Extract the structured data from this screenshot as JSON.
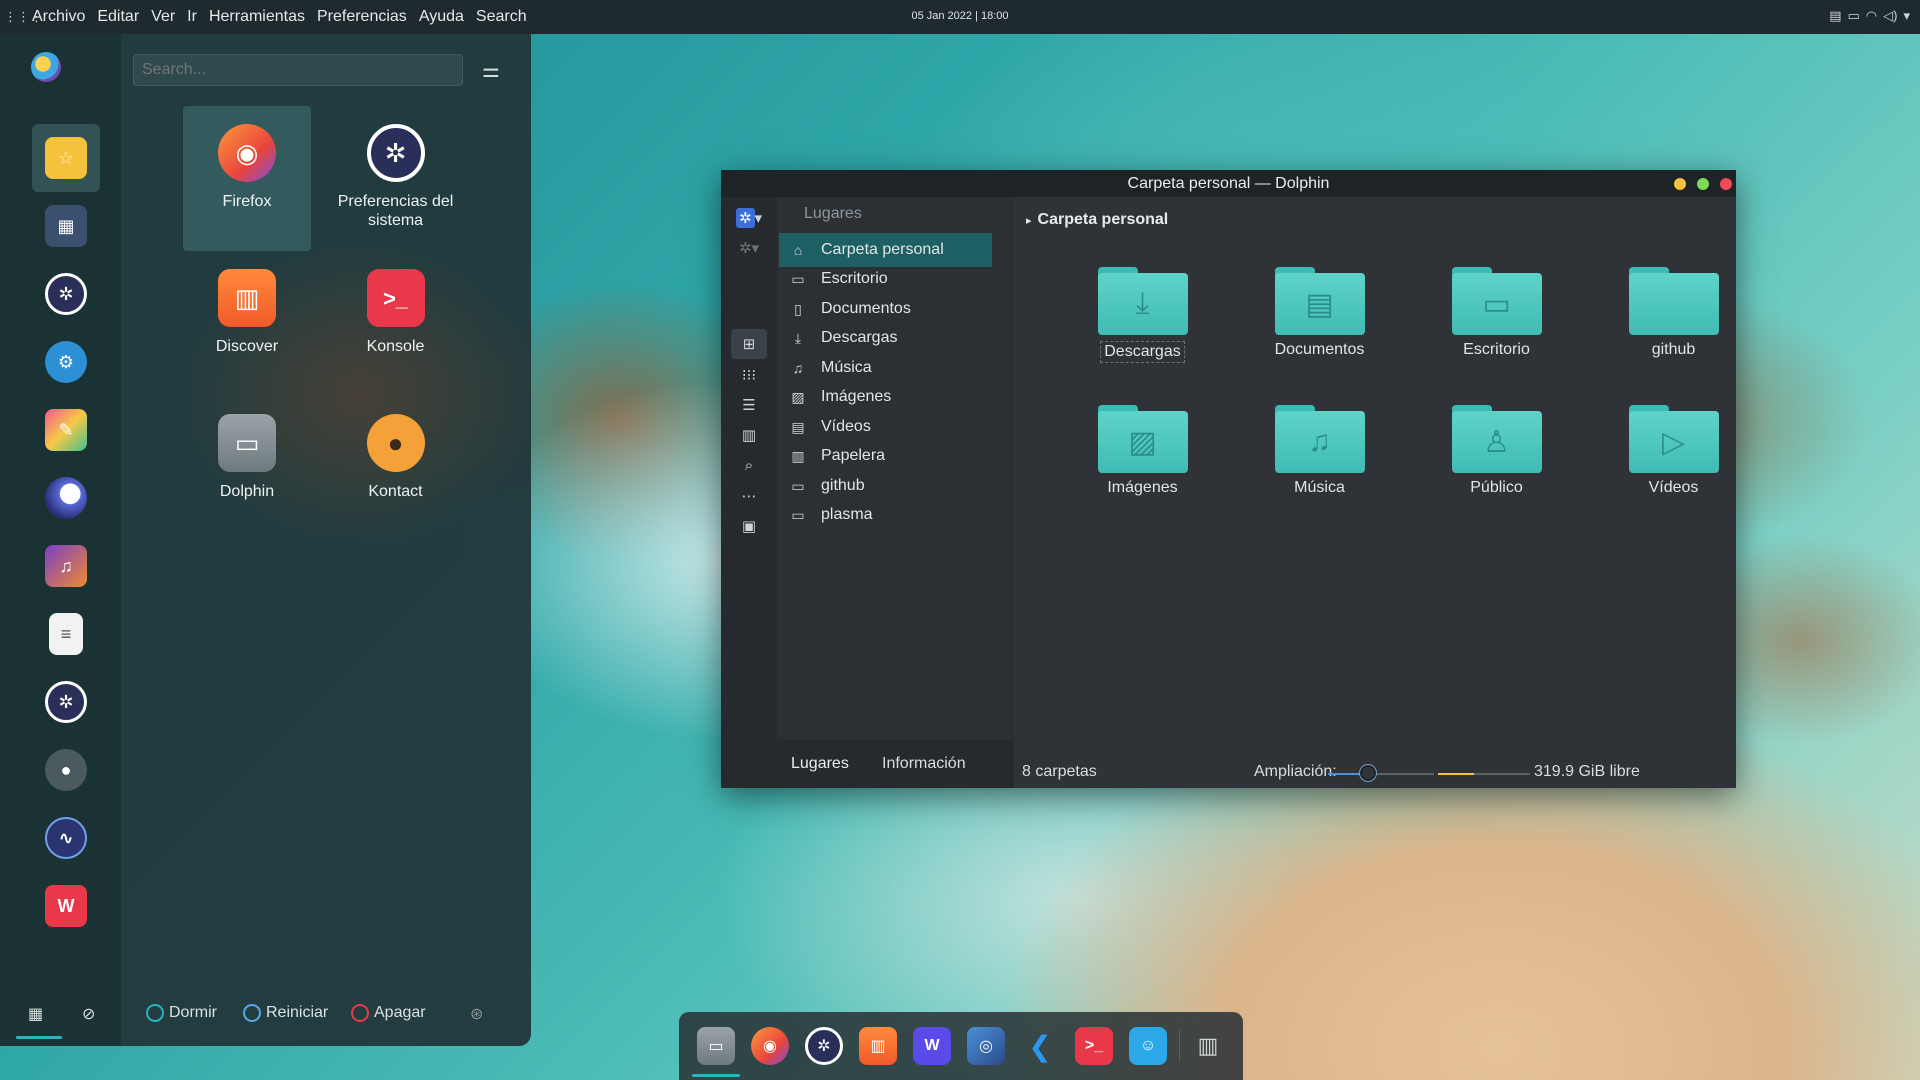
{
  "topbar": {
    "menu": [
      "Archivo",
      "Editar",
      "Ver",
      "Ir",
      "Herramientas",
      "Preferencias",
      "Ayuda",
      "Search"
    ],
    "clock": "05 Jan 2022 | 18:00"
  },
  "launcher": {
    "search_placeholder": "Search...",
    "apps": [
      "Firefox",
      "Preferencias del sistema",
      "Discover",
      "Konsole",
      "Dolphin",
      "Kontact"
    ],
    "bottom": {
      "sleep": "Dormir",
      "restart": "Reiniciar",
      "shutdown": "Apagar"
    }
  },
  "dolphin": {
    "title": "Carpeta personal — Dolphin",
    "places_header": "Lugares",
    "places": [
      "Carpeta personal",
      "Escritorio",
      "Documentos",
      "Descargas",
      "Música",
      "Imágenes",
      "Vídeos",
      "Papelera",
      "github",
      "plasma"
    ],
    "breadcrumb": "Carpeta personal",
    "folders": [
      "Descargas",
      "Documentos",
      "Escritorio",
      "github",
      "Imágenes",
      "Música",
      "Público",
      "Vídeos"
    ],
    "tabs": [
      "Lugares",
      "Información"
    ],
    "status": {
      "count": "8 carpetas",
      "zoom_label": "Ampliación:",
      "free": "319.9 GiB libre"
    }
  },
  "colors": {
    "accent": "#2ab3c0",
    "folder": "#4fc9c0",
    "selected_place": "#1e5f64"
  }
}
